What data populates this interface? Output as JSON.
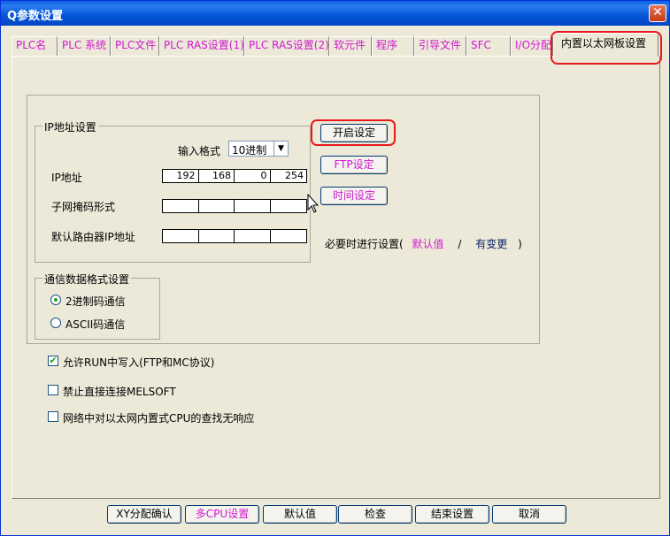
{
  "window": {
    "title": "Q参数设置",
    "close_glyph": "✕"
  },
  "tabs": [
    "PLC名",
    "PLC 系统",
    "PLC文件",
    "PLC RAS设置(1)",
    "PLC RAS设置(2)",
    "软元件",
    "程序",
    "引导文件",
    "SFC",
    "I/O分配",
    "内置以太网板设置"
  ],
  "ip_group": {
    "title": "IP地址设置",
    "input_format_label": "输入格式",
    "input_format_value": "10进制",
    "ip_label": "IP地址",
    "ip": [
      "192",
      "168",
      "0",
      "254"
    ],
    "subnet_label": "子网掩码形式",
    "subnet": [
      "",
      "",
      "",
      ""
    ],
    "gateway_label": "默认路由器IP地址",
    "gateway": [
      "",
      "",
      "",
      ""
    ]
  },
  "buttons": {
    "open_settings": "开启设定",
    "ftp_settings": "FTP设定",
    "time_settings": "时间设定"
  },
  "note": {
    "prefix": "必要时进行设置(",
    "default": "默认值",
    "slash": "/",
    "changed": "有变更",
    "suffix": ")"
  },
  "comm_group": {
    "title": "通信数据格式设置",
    "binary": "2进制码通信",
    "ascii": "ASCII码通信",
    "selected": "binary"
  },
  "checkboxes": {
    "allow_run_write": "允许RUN中写入(FTP和MC协议)",
    "allow_run_write_checked": true,
    "disable_direct_melsoft": "禁止直接连接MELSOFT",
    "disable_direct_melsoft_checked": false,
    "no_response_search": "网络中对以太网内置式CPU的查找无响应",
    "no_response_search_checked": false
  },
  "bottom_buttons": {
    "xy_confirm": "XY分配确认",
    "multi_cpu": "多CPU设置",
    "defaults": "默认值",
    "check": "检查",
    "finish": "结束设置",
    "cancel": "取消"
  },
  "colors": {
    "title_bar": "#0555d6",
    "tab_text": "#d01ad0",
    "highlight": "#e8191a",
    "face": "#ece9d8"
  }
}
